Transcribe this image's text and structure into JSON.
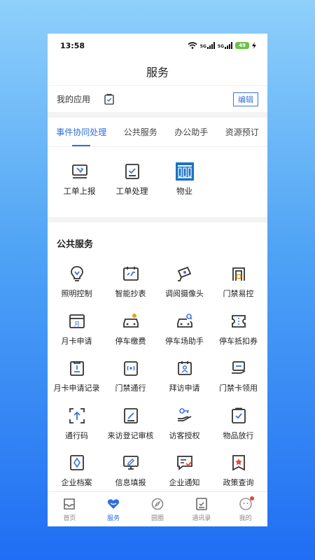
{
  "status": {
    "time": "13:58",
    "signal1": "5G",
    "signal2": "5G",
    "battery": "49"
  },
  "header": {
    "title": "服务"
  },
  "my_apps": {
    "label": "我的应用",
    "edit_label": "编辑"
  },
  "tabs": [
    {
      "label": "事件协同处理",
      "active": true
    },
    {
      "label": "公共服务",
      "active": false
    },
    {
      "label": "办公助手",
      "active": false
    },
    {
      "label": "资源预订",
      "active": false
    }
  ],
  "tab_items": [
    {
      "label": "工单上报",
      "icon": "tool-monitor-icon"
    },
    {
      "label": "工单处理",
      "icon": "check-doc-icon"
    },
    {
      "label": "物业",
      "icon": "building-logo-icon"
    }
  ],
  "public_services": {
    "title": "公共服务",
    "items": [
      {
        "label": "照明控制",
        "icon": "lightbulb-icon"
      },
      {
        "label": "智能抄表",
        "icon": "meter-icon"
      },
      {
        "label": "调阅摄像头",
        "icon": "camera-icon"
      },
      {
        "label": "门禁易控",
        "icon": "gate-icon"
      },
      {
        "label": "月卡申请",
        "icon": "calendar-month-icon"
      },
      {
        "label": "停车缴费",
        "icon": "car-pay-icon"
      },
      {
        "label": "停车场助手",
        "icon": "car-search-icon"
      },
      {
        "label": "停车抵扣券",
        "icon": "ticket-icon"
      },
      {
        "label": "月卡申请记录",
        "icon": "record-icon"
      },
      {
        "label": "门禁通行",
        "icon": "access-pass-icon"
      },
      {
        "label": "拜访申请",
        "icon": "visit-icon"
      },
      {
        "label": "门禁卡领用",
        "icon": "card-collect-icon"
      },
      {
        "label": "通行码",
        "icon": "scan-code-icon"
      },
      {
        "label": "来访登记审核",
        "icon": "register-audit-icon"
      },
      {
        "label": "访客授权",
        "icon": "key-hand-icon"
      },
      {
        "label": "物品放行",
        "icon": "clipboard-check-icon"
      },
      {
        "label": "企业档案",
        "icon": "archive-icon"
      },
      {
        "label": "信息填报",
        "icon": "monitor-edit-icon"
      },
      {
        "label": "企业通知",
        "icon": "notice-icon"
      },
      {
        "label": "政策查询",
        "icon": "policy-star-icon"
      }
    ]
  },
  "nav": [
    {
      "label": "首页",
      "icon": "inbox-icon",
      "active": false
    },
    {
      "label": "服务",
      "icon": "heart-icon",
      "active": true
    },
    {
      "label": "圆圈",
      "icon": "compass-icon",
      "active": false
    },
    {
      "label": "通讯录",
      "icon": "contacts-icon",
      "active": false
    },
    {
      "label": "我的",
      "icon": "smile-icon",
      "active": false
    }
  ],
  "colors": {
    "accent": "#2d6fe0",
    "icon_dark": "#333333",
    "icon_accent": "#3b73d9",
    "badge": "#e7453b"
  }
}
